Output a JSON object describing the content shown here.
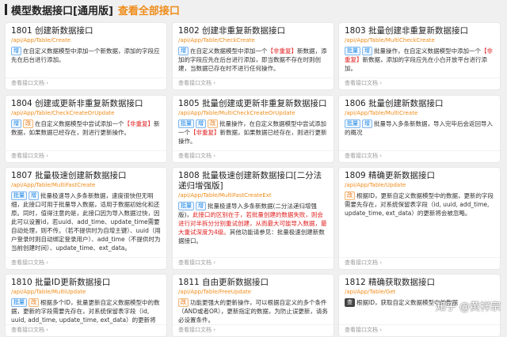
{
  "header": {
    "title": "模型数据接口[通用版]",
    "link": "查看全部接口"
  },
  "footer_label": "查看接口文档 ›",
  "cards": [
    {
      "title": "1801 创建新数据接口",
      "url": "/api/App/Table/Create",
      "tags": [
        "增"
      ],
      "desc": [
        "在自定义数据模型中添加一个新数据，添加的字段应先在后台进行添加。"
      ]
    },
    {
      "title": "1802 创建非重复新数据接口",
      "url": "/api/App/Table/CheckCreate",
      "tags": [
        "增"
      ],
      "desc": [
        "在自定义数据模型中添加一个",
        "【非重复】",
        "新数据，添加的字段应先在后台进行添加，即当数据不存在时则创建，当数据已存在时不进行任何操作。"
      ]
    },
    {
      "title": "1803 批量创建非重复新数据接口",
      "url": "/api/App/Table/MultiCheckCreate",
      "tags": [
        "批量",
        "增"
      ],
      "desc": [
        "批量操作，在自定义数据模型中添加一个",
        "【非重复】",
        "新数据，添加的字段应先在小白开放平台进行添加。"
      ]
    },
    {
      "title": "1804 创建或更新非重复新数据接口",
      "url": "/api/App/Table/CheckCreateOrUpdate",
      "tags": [
        "增",
        "改"
      ],
      "desc": [
        "在自定义数据模型中尝试添加一个",
        "【非重复】",
        "新数据，如果数据已经存在，则进行更新操作。"
      ]
    },
    {
      "title": "1805 批量创建或更新非重复新数据接口",
      "url": "/api/App/Table/MultiCheckCreateOrUpdate",
      "tags": [
        "批量",
        "增",
        "改"
      ],
      "desc": [
        "批量操作，在自定义数据模型中尝试添加一个",
        "【非重复】",
        "新数据，如果数据已经存在，则进行更新操作。"
      ]
    },
    {
      "title": "1806 批量创建新数据接口",
      "url": "/api/App/Table/MultiCreate",
      "tags": [
        "批量",
        "增"
      ],
      "desc": [
        "批量导入多条新数据，导入完毕后会返回导入的概况"
      ]
    },
    {
      "title": "1807 批量极速创建新数据接口",
      "url": "/api/App/Table/MultiFastCreate",
      "tags": [
        "批量",
        "增"
      ],
      "desc": [
        "批量极速导入多条新数据，速度很快但无明细，此接口可用于批量导入数据，适用于数据初始化和还原。同时，值得注意的是，此接口因为导入数据过快，因此可以设置id，若uuid、add_time、update_time需要自动处理，则不传。（若不提供时为自增主键）、uuid（用户登录时则自动绑定登录用户）、add_time（不提供时为当前创建时间）、update_time、ext_data。"
      ]
    },
    {
      "title": "1808 批量极速创建新数据接口[二分法递归增强版]",
      "url": "/api/App/Table/MultiFastCreateExt",
      "tags": [
        "批量",
        "增"
      ],
      "desc": [
        "批量极速导入多条新数据(二分法递归增强版)，",
        "此接口的区别在于，若批量创建的数据失败，则会进行对半拆分分别重试创建，从而最大可能导入数据，最大重试深度为4级。",
        "其他功能请参见：批量极速创建新数据接口。"
      ]
    },
    {
      "title": "1809 精确更新数据接口",
      "url": "/api/App/Table/Update",
      "tags": [
        "改"
      ],
      "desc": [
        "根据ID，更新自定义数据模型中的数据，更新的字段需要先存在，对系统保留表字段（id, uuid, add_time, update_time, ext_data）的更新将会被忽略。"
      ]
    },
    {
      "title": "1810 批量ID更新数据接口",
      "url": "/api/App/Table/MultiUpdate",
      "tags": [
        "批量",
        "改"
      ],
      "desc": [
        "根据多个ID，批量更新自定义数据模型中的数据，更新的字段需要先存在，对系统保留表字段（id, uuid, add_time, update_time, ext_data）的更新将"
      ]
    },
    {
      "title": "1811 自由更新数据接口",
      "url": "/api/App/Table/FreeUpdate",
      "tags": [
        "改"
      ],
      "desc": [
        "功能更强大的更新操作，可以根据自定义的多个条件（AND或者OR），更新指定的数据，为防止误更新，请务必设置条件。"
      ]
    },
    {
      "title": "1812 精确获取数据接口",
      "url": "/api/App/Table/Get",
      "tags": [
        "查"
      ],
      "desc": [
        "根据ID，获取自定义数据模型中的数据"
      ]
    }
  ],
  "watermark": "知乎 @黄祥宗"
}
